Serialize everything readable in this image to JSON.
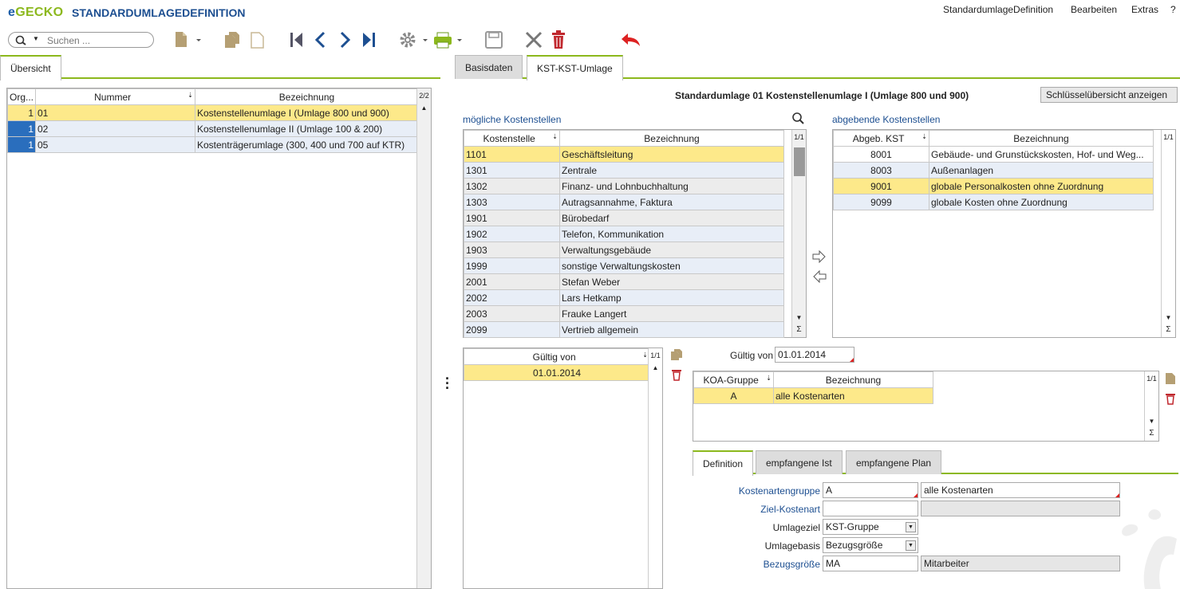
{
  "app": {
    "brand_e": "e",
    "brand_rest": "GECKO",
    "title": "STANDARDUMLAGEDEFINITION"
  },
  "menu": {
    "item1": "StandardumlageDefinition",
    "item2": "Bearbeiten",
    "item3": "Extras",
    "help": "?"
  },
  "search": {
    "placeholder": "Suchen ..."
  },
  "left": {
    "tab": "Übersicht",
    "page": "2/2",
    "headers": [
      "Org...",
      "Nummer",
      "Bezeichnung"
    ],
    "rows": [
      {
        "org": "1",
        "nr": "01",
        "bez": "Kostenstellenumlage I (Umlage 800 und 900)"
      },
      {
        "org": "1",
        "nr": "02",
        "bez": "Kostenstellenumlage II (Umlage 100 & 200)"
      },
      {
        "org": "1",
        "nr": "05",
        "bez": "Kostenträgerumlage (300, 400 und 700 auf KTR)"
      }
    ]
  },
  "tabs": {
    "t1": "Basisdaten",
    "t2": "KST-KST-Umlage"
  },
  "header": {
    "title": "Standardumlage 01 Kostenstellenumlage I (Umlage 800 und 900)",
    "key_button": "Schlüsselübersicht anzeigen"
  },
  "possible": {
    "label": "mögliche Kostenstellen",
    "page": "1/1",
    "headers": [
      "Kostenstelle",
      "Bezeichnung"
    ],
    "rows": [
      [
        "1101",
        "Geschäftsleitung"
      ],
      [
        "1301",
        "Zentrale"
      ],
      [
        "1302",
        "Finanz- und Lohnbuchhaltung"
      ],
      [
        "1303",
        "Autragsannahme, Faktura"
      ],
      [
        "1901",
        "Bürobedarf"
      ],
      [
        "1902",
        "Telefon, Kommunikation"
      ],
      [
        "1903",
        "Verwaltungsgebäude"
      ],
      [
        "1999",
        "sonstige Verwaltungskosten"
      ],
      [
        "2001",
        "Stefan Weber"
      ],
      [
        "2002",
        "Lars Hetkamp"
      ],
      [
        "2003",
        "Frauke Langert"
      ],
      [
        "2099",
        "Vertrieb allgemein"
      ]
    ]
  },
  "giving": {
    "label": "abgebende Kostenstellen",
    "page": "1/1",
    "headers": [
      "Abgeb. KST",
      "Bezeichnung"
    ],
    "rows": [
      [
        "8001",
        "Gebäude- und Grunstückskosten, Hof- und Weg..."
      ],
      [
        "8003",
        "Außenanlagen"
      ],
      [
        "9001",
        "globale Personalkosten ohne Zuordnung"
      ],
      [
        "9099",
        "globale Kosten ohne Zuordnung"
      ]
    ]
  },
  "valid": {
    "header": "Gültig von",
    "page": "1/1",
    "rows": [
      "01.01.2014"
    ]
  },
  "valid_field": {
    "label": "Gültig von",
    "value": "01.01.2014"
  },
  "koa": {
    "page": "1/1",
    "headers": [
      "KOA-Gruppe",
      "Bezeichnung"
    ],
    "rows": [
      [
        "A",
        "alle Kostenarten"
      ]
    ]
  },
  "subtabs": {
    "t1": "Definition",
    "t2": "empfangene Ist",
    "t3": "empfangene Plan"
  },
  "form": {
    "kag_label": "Kostenartengruppe",
    "kag_value": "A",
    "kag_desc": "alle Kostenarten",
    "zk_label": "Ziel-Kostenart",
    "uz_label": "Umlageziel",
    "uz_value": "KST-Gruppe",
    "ub_label": "Umlagebasis",
    "ub_value": "Bezugsgröße",
    "bg_label": "Bezugsgröße",
    "bg_value": "MA",
    "bg_desc": "Mitarbeiter"
  },
  "sigma": "Σ",
  "colors": {
    "accent": "#8cb81d",
    "brand_blue": "#1d4f91",
    "selected_row": "#fde98a",
    "alt_row": "#e8eef7"
  }
}
